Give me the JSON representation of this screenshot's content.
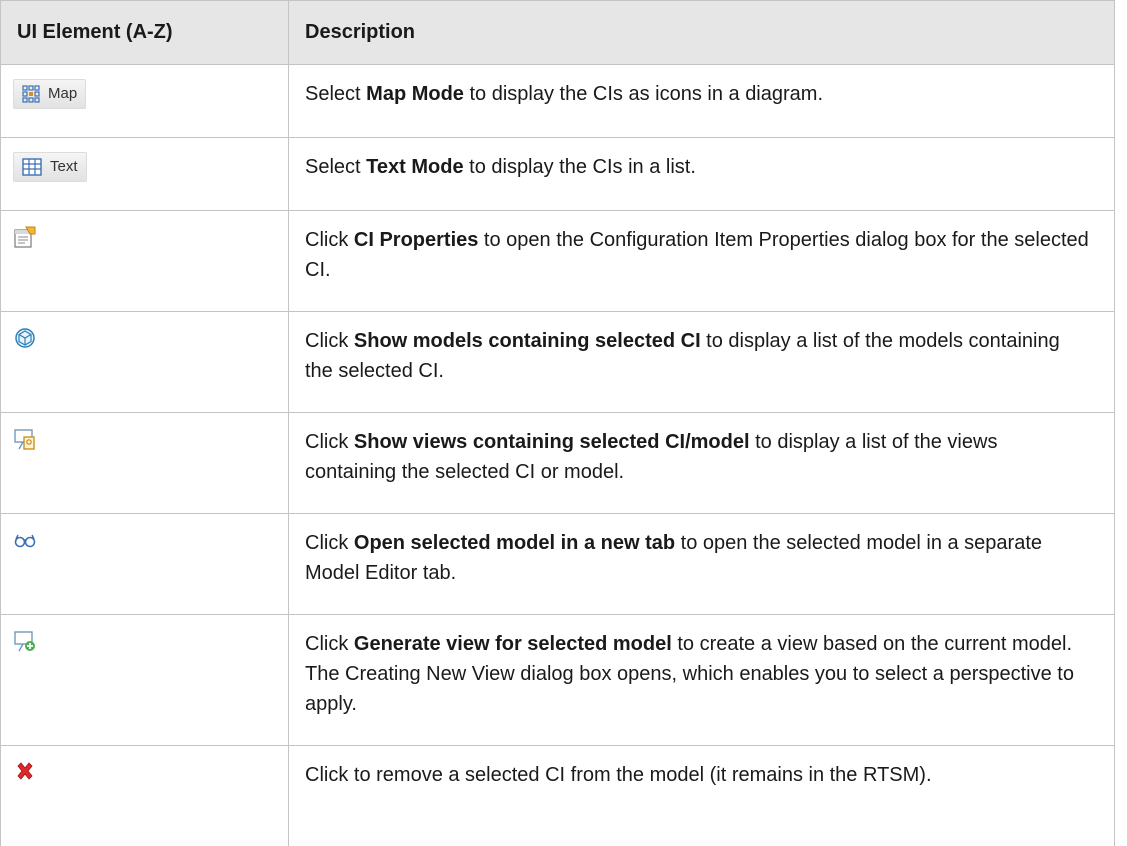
{
  "table": {
    "header_element": "UI Element (A-Z)",
    "header_description": "Description",
    "rows": [
      {
        "button_label": "Map",
        "icon": "map-mode-icon",
        "desc": [
          {
            "t": "Select ",
            "b": false
          },
          {
            "t": "Map Mode",
            "b": true
          },
          {
            "t": " to display the CIs as icons in a diagram.",
            "b": false
          }
        ]
      },
      {
        "button_label": "Text",
        "icon": "text-mode-icon",
        "desc": [
          {
            "t": "Select ",
            "b": false
          },
          {
            "t": "Text Mode",
            "b": true
          },
          {
            "t": " to display the CIs in a list.",
            "b": false
          }
        ]
      },
      {
        "icon": "ci-properties-icon",
        "desc": [
          {
            "t": "Click ",
            "b": false
          },
          {
            "t": "CI Properties",
            "b": true
          },
          {
            "t": " to open the Configuration Item Properties dialog box for the selected CI.",
            "b": false
          }
        ]
      },
      {
        "icon": "show-models-icon",
        "desc": [
          {
            "t": "Click ",
            "b": false
          },
          {
            "t": "Show models containing selected CI",
            "b": true
          },
          {
            "t": " to display a list of the models containing the selected CI.",
            "b": false
          }
        ]
      },
      {
        "icon": "show-views-icon",
        "desc": [
          {
            "t": "Click ",
            "b": false
          },
          {
            "t": "Show views containing selected CI/model",
            "b": true
          },
          {
            "t": " to display a list of the views containing the selected CI or model.",
            "b": false
          }
        ]
      },
      {
        "icon": "open-model-new-tab-icon",
        "desc": [
          {
            "t": "Click ",
            "b": false
          },
          {
            "t": "Open selected model in a new tab",
            "b": true
          },
          {
            "t": " to open the selected model in a separate Model Editor tab.",
            "b": false
          }
        ]
      },
      {
        "icon": "generate-view-icon",
        "desc": [
          {
            "t": "Click ",
            "b": false
          },
          {
            "t": "Generate view for selected model",
            "b": true
          },
          {
            "t": " to create a view based on the current model. The Creating New View dialog box opens, which enables you to select a perspective to apply.",
            "b": false
          }
        ]
      },
      {
        "icon": "remove-ci-icon",
        "desc": [
          {
            "t": "Click to remove a selected CI from the model (it remains in the RTSM).",
            "b": false
          }
        ]
      }
    ]
  }
}
